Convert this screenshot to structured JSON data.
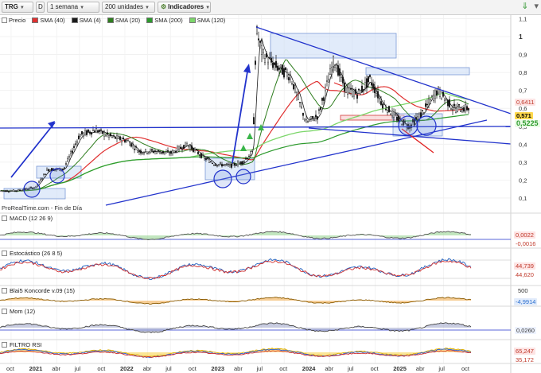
{
  "toolbar": {
    "ticker": "TRG",
    "mode": "D",
    "period": "1 semana",
    "units": "200 unidades",
    "indicators": "Indicadores"
  },
  "legend": {
    "price": "Precio",
    "sma40": "SMA (40)",
    "sma4": "SMA (4)",
    "sma20": "SMA (20)",
    "sma200": "SMA (200)",
    "sma120": "SMA (120)"
  },
  "colors": {
    "sma40": "#e03030",
    "sma4": "#1a1a1a",
    "sma20": "#2e7d1e",
    "sma200": "#2c9a2c",
    "sma120": "#7cd66a",
    "trendline": "#2233cc"
  },
  "price_axis": [
    "1,1",
    "1",
    "0,9",
    "0,8",
    "0,7",
    "0,6",
    "0,5",
    "0,4",
    "0,3",
    "0,2",
    "0,1"
  ],
  "price_tags": {
    "p1": "0,6411",
    "p2": "0,571",
    "p3": "0,5225"
  },
  "source": "ProRealTime.com - Fin de Día",
  "panels": {
    "macd": {
      "label": "MACD (12 26 9)",
      "v1": "0,0022",
      "v2": "-0,0016"
    },
    "stoch": {
      "label": "Estocástico (26 8 5)",
      "v1": "44,739",
      "v2": "44,620"
    },
    "blai": {
      "label": "Blai5 Koncorde v.09 (15)",
      "top": "500",
      "v1": "-4,9914"
    },
    "mom": {
      "label": "Mom (12)",
      "v1": "0,0260"
    },
    "rsi": {
      "label": "FILTRO RSI",
      "v1": "65,247",
      "v2": "35,172"
    }
  },
  "time_axis": [
    "oct",
    "2021",
    "abr",
    "jul",
    "oct",
    "2022",
    "abr",
    "jul",
    "oct",
    "2023",
    "abr",
    "jul",
    "oct",
    "2024",
    "abr",
    "jul",
    "oct",
    "2025",
    "abr",
    "jul",
    "oct"
  ]
}
